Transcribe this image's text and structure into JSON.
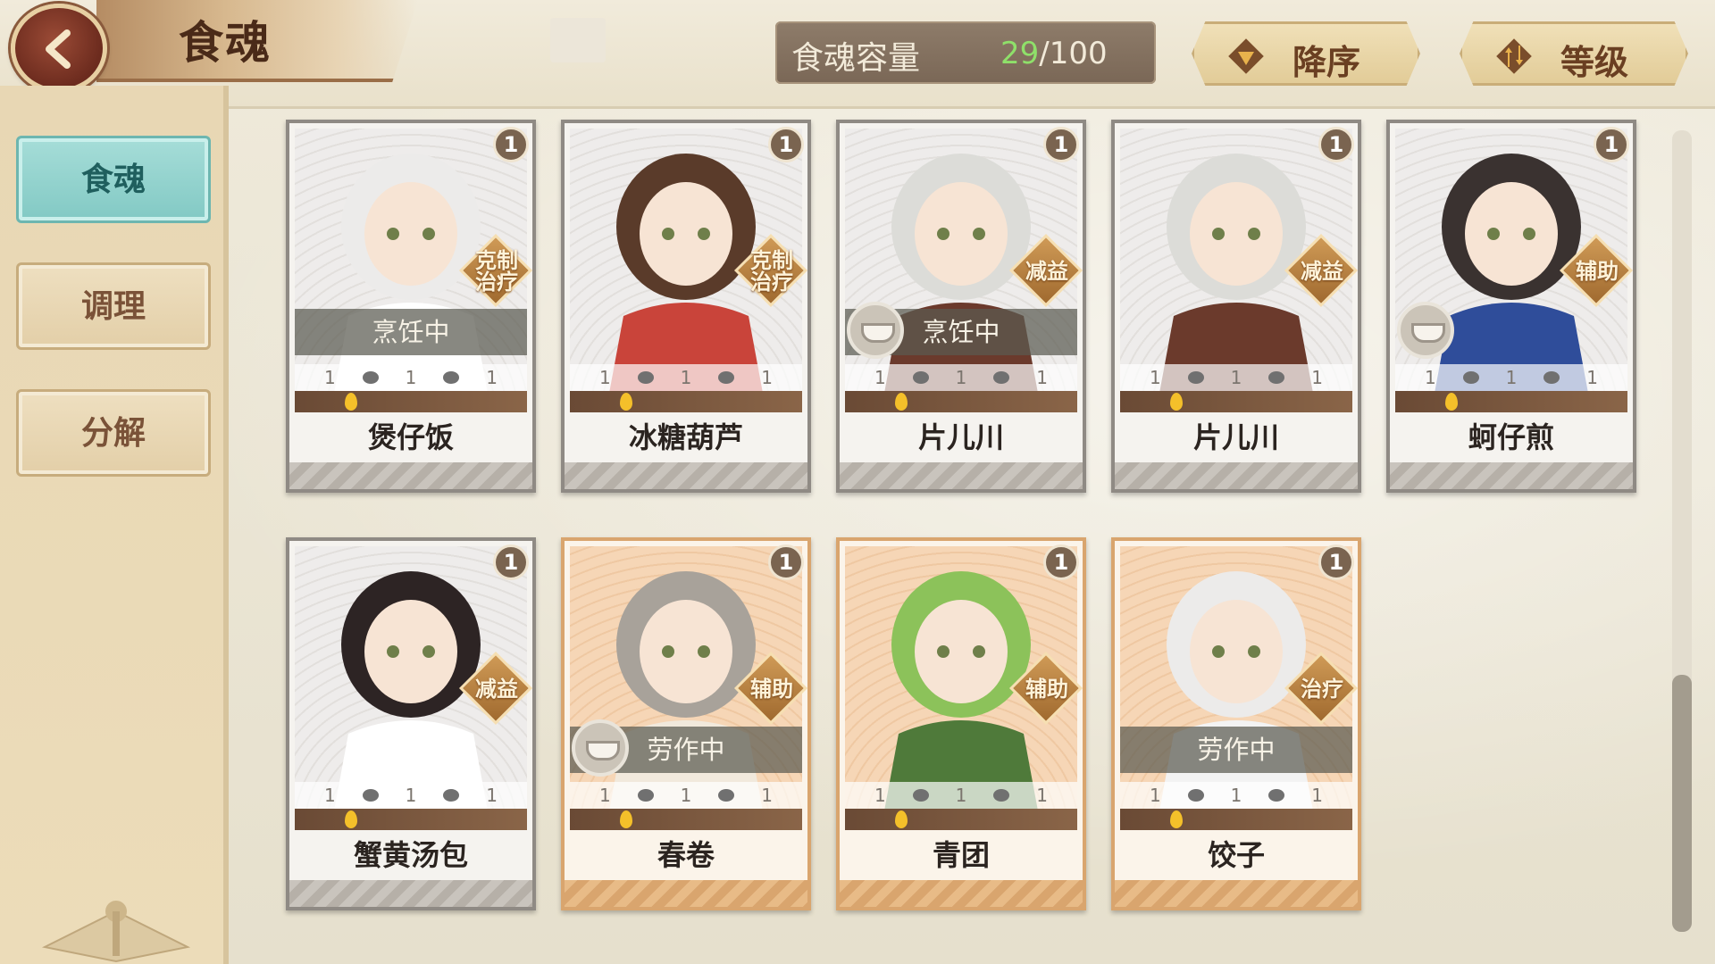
{
  "header": {
    "title": "食魂",
    "capacity_label": "食魂容量",
    "capacity_current": "29",
    "capacity_total": "/100",
    "sort_order_label": "降序",
    "sort_key_label": "等级"
  },
  "sidebar": {
    "items": [
      {
        "label": "食魂",
        "active": true
      },
      {
        "label": "调理",
        "active": false
      },
      {
        "label": "分解",
        "active": false
      }
    ]
  },
  "cards": [
    {
      "name": "煲仔饭",
      "level": "1",
      "role": "克制\n治疗",
      "status": "烹饪中",
      "has_status_icon": false,
      "stats": [
        "1",
        "1",
        "1"
      ],
      "rarity": "silver"
    },
    {
      "name": "冰糖葫芦",
      "level": "1",
      "role": "克制\n治疗",
      "status": "",
      "has_status_icon": false,
      "stats": [
        "1",
        "1",
        "1"
      ],
      "rarity": "silver"
    },
    {
      "name": "片儿川",
      "level": "1",
      "role": "减益",
      "status": "烹饪中",
      "has_status_icon": true,
      "stats": [
        "1",
        "1",
        "1"
      ],
      "rarity": "silver"
    },
    {
      "name": "片儿川",
      "level": "1",
      "role": "减益",
      "status": "",
      "has_status_icon": false,
      "stats": [
        "1",
        "1",
        "1"
      ],
      "rarity": "silver"
    },
    {
      "name": "蚵仔煎",
      "level": "1",
      "role": "辅助",
      "status": "",
      "has_status_icon": true,
      "stats": [
        "1",
        "1",
        "1"
      ],
      "rarity": "silver"
    },
    {
      "name": "蟹黄汤包",
      "level": "1",
      "role": "减益",
      "status": "",
      "has_status_icon": false,
      "stats": [
        "1",
        "1",
        "1"
      ],
      "rarity": "silver"
    },
    {
      "name": "春卷",
      "level": "1",
      "role": "辅助",
      "status": "劳作中",
      "has_status_icon": true,
      "stats": [
        "1",
        "1",
        "1"
      ],
      "rarity": "gold"
    },
    {
      "name": "青团",
      "level": "1",
      "role": "辅助",
      "status": "",
      "has_status_icon": false,
      "stats": [
        "1",
        "1",
        "1"
      ],
      "rarity": "gold"
    },
    {
      "name": "饺子",
      "level": "1",
      "role": "治疗",
      "status": "劳作中",
      "has_status_icon": false,
      "stats": [
        "1",
        "1",
        "1"
      ],
      "rarity": "gold"
    }
  ],
  "colors": {
    "accent_teal": "#82c9c4",
    "capacity_current": "#8fe06a",
    "role_tag": "#b57a3a"
  },
  "icons": {
    "back": "chevron-left-icon",
    "sort_order": "triangle-down-icon",
    "sort_key": "sort-arrows-icon",
    "status": "bowl-icon",
    "level": "level-badge",
    "flame": "flame-icon"
  }
}
